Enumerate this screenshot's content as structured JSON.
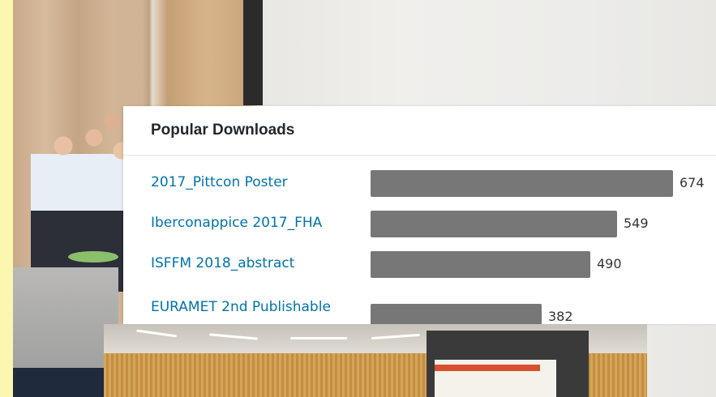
{
  "widget": {
    "title": "Popular Downloads",
    "bar_color": "#777777",
    "link_color": "#0073aa",
    "max_value": 674,
    "items": [
      {
        "label": "2017_Pittcon Poster",
        "count": 674
      },
      {
        "label": "Iberconappice 2017_FHA",
        "count": 549
      },
      {
        "label": "ISFFM 2018_abstract",
        "count": 490
      },
      {
        "label": "EURAMET 2nd Publishable",
        "count": 382
      }
    ]
  }
}
